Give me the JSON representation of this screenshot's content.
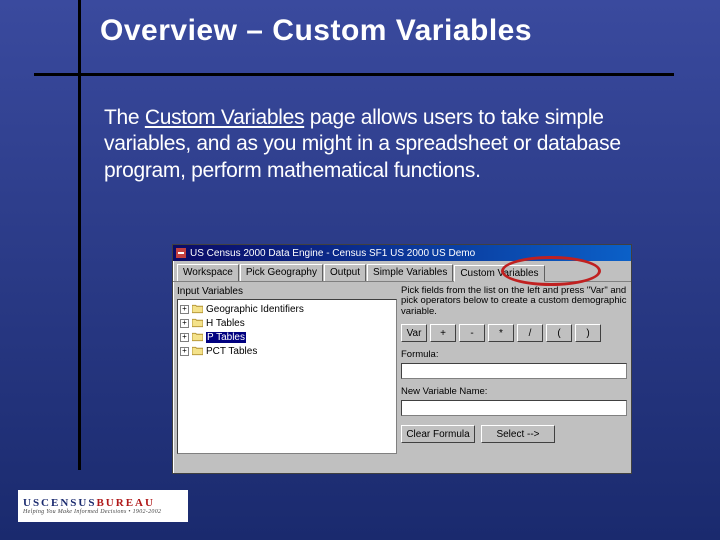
{
  "slide": {
    "title": "Overview – Custom Variables",
    "body_pre": "The ",
    "body_underlined": "Custom Variables",
    "body_post": " page allows users to take simple variables, and as you might in a spreadsheet or database program, perform mathematical functions."
  },
  "window": {
    "title": "US Census 2000 Data Engine - Census SF1 US 2000 US Demo",
    "tabs": [
      "Workspace",
      "Pick Geography",
      "Output",
      "Simple Variables",
      "Custom Variables"
    ],
    "active_tab": 4,
    "left_label": "Input Variables",
    "tree": [
      {
        "label": "Geographic Identifiers",
        "selected": false
      },
      {
        "label": "H Tables",
        "selected": false
      },
      {
        "label": "P Tables",
        "selected": true
      },
      {
        "label": "PCT Tables",
        "selected": false
      }
    ],
    "right_hint": "Pick fields from the list on the left and press \"Var\" and pick operators below to create a custom demographic variable.",
    "op_buttons": [
      "Var",
      "+",
      "-",
      "*",
      "/",
      "(",
      ")"
    ],
    "formula_label": "Formula:",
    "newvar_label": "New Variable Name:",
    "bottom_buttons": [
      "Clear Formula",
      "Select -->"
    ]
  },
  "logo": {
    "line1a": "USCENSUS",
    "line1b": "BUREAU",
    "line2": "Helping You Make Informed Decisions • 1902-2002"
  }
}
